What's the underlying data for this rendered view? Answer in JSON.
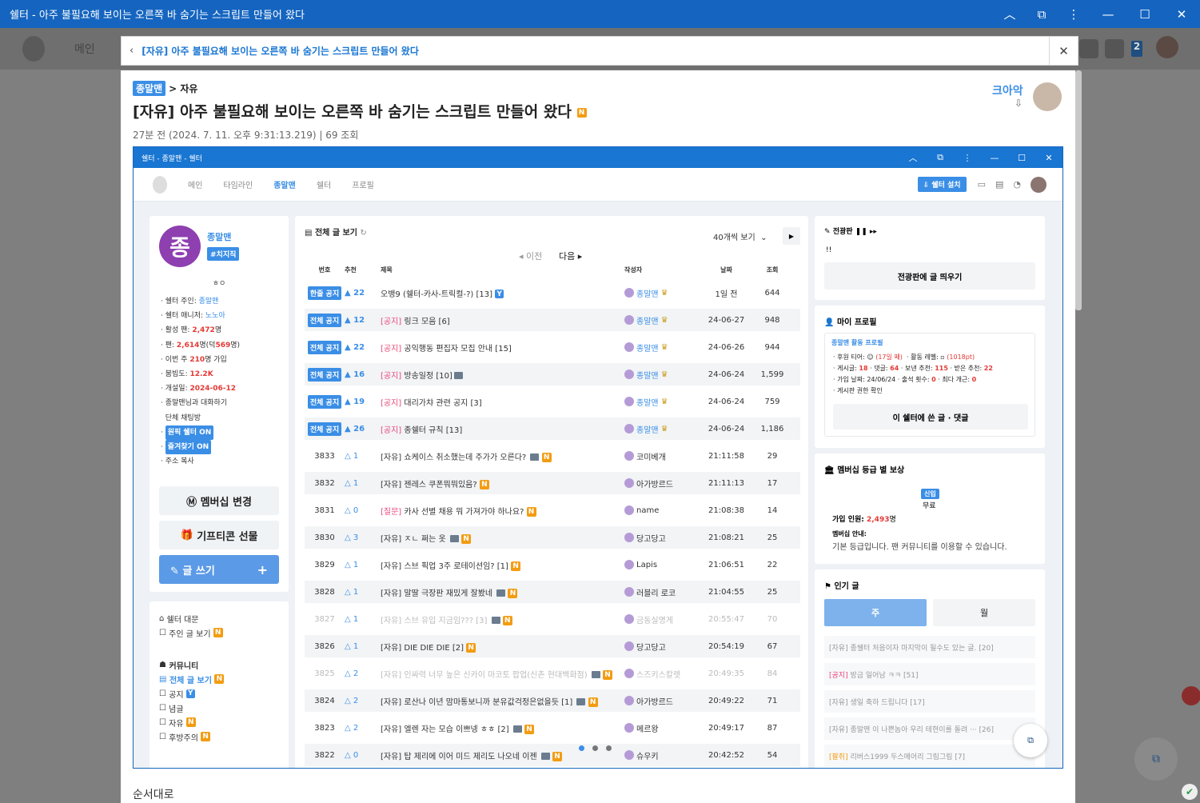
{
  "window": {
    "title": "쉘터 - 아주 불필요해 보이는 오른쪽 바 숨기는 스크립트 만들어 왔다"
  },
  "bg_nav": {
    "main": "메인",
    "notif_count": "2"
  },
  "navbar": {
    "title": "[자유] 아주 불필요해 보이는 오른쪽 바 숨기는 스크립트 만들어 왔다"
  },
  "post": {
    "board_badge": "종말맨",
    "board_path": "> 자유",
    "title": "[자유] 아주 불필요해 보이는 오른쪽 바 숨기는 스크립트 만들어 왔다",
    "new_badge": "N",
    "meta": "27분 전 (2024. 7. 11. 오후 9:31:13.219) | 69 조회",
    "author": "크아악",
    "body_text": "순서대로"
  },
  "shot": {
    "title": "쉘터 - 종말맨 - 쉘터",
    "nav": [
      "메인",
      "타임라인",
      "종말맨",
      "쉘터",
      "프로필"
    ],
    "install_btn": "쉘터 설치",
    "profile": {
      "avatar_char": "종",
      "name": "종말맨",
      "tag": "#치지직",
      "motto": "ㅎㅇ",
      "owner_label": "쉘터 주인:",
      "owner": "종말맨",
      "manager_label": "쉘터 매니저:",
      "manager": "노노아",
      "active_label": "활성 팬:",
      "active": "2,472",
      "unit_people": "명",
      "fans_label": "팬:",
      "fans": "2,614",
      "fans_mid": "명(덕",
      "fans_de": "569",
      "fans_end": "명)",
      "week_label": "이번 주",
      "week": "210",
      "week_end": "명 가입",
      "busy_label": "붐빔도:",
      "busy": "12.2K",
      "opened_label": "개설일:",
      "opened": "2024-06-12",
      "chat_link": "종말맨님과 대화하기",
      "group_chat": "단체 채팅방",
      "btn_pin": "원픽 쉘터 ON",
      "btn_fav": "즐겨찾기 ON",
      "copy_addr": "주소 복사",
      "membership_btn": "멤버십 변경",
      "gift_btn": "기프티콘 선물",
      "write_btn": "글 쓰기"
    },
    "side_links": {
      "door": "쉘터 대문",
      "owner_posts": "주인 글 보기",
      "community": "커뮤니티",
      "all_posts": "전체 글 보기",
      "notice": "공지",
      "best": "념글",
      "free": "자유",
      "rookie": "후방주의"
    },
    "list": {
      "heading": "전체 글 보기",
      "per_page": "40개씩 보기",
      "prev": "이전",
      "next": "다음",
      "headers": [
        "번호",
        "추천",
        "제목",
        "작성자",
        "날짜",
        "조회"
      ],
      "rows": [
        {
          "num": "한줄 공지",
          "rec": "▲ 22",
          "tag": "",
          "title": "오뱅9 (쉘터-카사-트릭컬-?) [13]",
          "author": "종말맨",
          "date": "1일 전",
          "views": "644"
        },
        {
          "num": "전체 공지",
          "rec": "▲ 12",
          "tag": "[공지]",
          "title": "링크 모음 [6]",
          "author": "종말맨",
          "date": "24-06-27",
          "views": "948"
        },
        {
          "num": "전체 공지",
          "rec": "▲ 22",
          "tag": "[공지]",
          "title": "공익행동 편집자 모집 안내 [15]",
          "author": "종말맨",
          "date": "24-06-26",
          "views": "944"
        },
        {
          "num": "전체 공지",
          "rec": "▲ 16",
          "tag": "[공지]",
          "title": "방송일정 [10]",
          "author": "종말맨",
          "date": "24-06-24",
          "views": "1,599"
        },
        {
          "num": "전체 공지",
          "rec": "▲ 19",
          "tag": "[공지]",
          "title": "대리가챠 관련 공지 [3]",
          "author": "종말맨",
          "date": "24-06-24",
          "views": "759"
        },
        {
          "num": "전체 공지",
          "rec": "▲ 26",
          "tag": "[공지]",
          "title": "종쉘터 규칙 [13]",
          "author": "종말맨",
          "date": "24-06-24",
          "views": "1,186"
        },
        {
          "num": "3833",
          "rec": "△ 1",
          "tag": "",
          "title": "[자유] 쇼케이스 취소했는데 주가가 오른다? ",
          "author": "코미베개",
          "date": "21:11:58",
          "views": "29"
        },
        {
          "num": "3832",
          "rec": "△ 1",
          "tag": "",
          "title": "[자유] 젠레스 쿠폰뭐뭐있음? ",
          "author": "아가방르드",
          "date": "21:11:13",
          "views": "17"
        },
        {
          "num": "3831",
          "rec": "△ 0",
          "tag": "[질문]",
          "title": "카사 선별 채용 뭐 가져가야 하나요? ",
          "author": "name",
          "date": "21:08:38",
          "views": "14"
        },
        {
          "num": "3830",
          "rec": "△ 3",
          "tag": "",
          "title": "[자유] ㅈㄴ 쩌는 옷 ",
          "author": "당고당고",
          "date": "21:08:21",
          "views": "25"
        },
        {
          "num": "3829",
          "rec": "△ 1",
          "tag": "",
          "title": "[자유] 스브 픽업 3주 로테이션임? [1] ",
          "author": "Lapis",
          "date": "21:06:51",
          "views": "22"
        },
        {
          "num": "3828",
          "rec": "△ 1",
          "tag": "",
          "title": "[자유] 말딸 극장판 재밌게 잘봤네 ",
          "author": "러블리 로코",
          "date": "21:04:55",
          "views": "25"
        },
        {
          "num": "3827",
          "rec": "△ 1",
          "tag": "",
          "title": "[자유] 스브 유입 지금임??? [3] ",
          "author": "금동실명게",
          "date": "20:55:47",
          "views": "70"
        },
        {
          "num": "3826",
          "rec": "△ 1",
          "tag": "",
          "title": "[자유] DIE DIE DIE [2] ",
          "author": "당고당고",
          "date": "20:54:19",
          "views": "67"
        },
        {
          "num": "3825",
          "rec": "△ 2",
          "tag": "",
          "title": "[자유] 인싸력 너무 높은 신카이 마코토 팝업(신촌 현대백화점) ",
          "author": "스즈키스칼렛",
          "date": "20:49:35",
          "views": "84"
        },
        {
          "num": "3824",
          "rec": "△ 2",
          "tag": "",
          "title": "[자유] 로산나 이년 맘마통보니까 분유값걱정은없을듯 [1] ",
          "author": "아가방르드",
          "date": "20:49:22",
          "views": "71"
        },
        {
          "num": "3823",
          "rec": "△ 2",
          "tag": "",
          "title": "[자유] 엘렌 자는 모습 이쁘넹 ㅎㅎ [2] ",
          "author": "메르왕",
          "date": "20:49:17",
          "views": "87"
        },
        {
          "num": "3822",
          "rec": "△ 0",
          "tag": "",
          "title": "[자유] 탑 제리에 이어 미드 제리도 나오네 이젠 ",
          "author": "슈우키",
          "date": "20:42:52",
          "views": "54"
        }
      ]
    },
    "board_panel": {
      "heading": "전광판",
      "text": "!!",
      "btn": "전광판에 글 띄우기"
    },
    "my_profile": {
      "heading": "마이 프로필",
      "sub": "종말맨 활동 프로필",
      "l1a": "후원 티어:",
      "l1b": "(17일 째)",
      "l1c": "활동 레벨:",
      "l1d": "(1018pt)",
      "l2a": "게시글:",
      "l2b": "18",
      "l2c": "댓글:",
      "l2d": "64",
      "l2e": "보낸 추천:",
      "l2f": "115",
      "l2g": "받은 추천:",
      "l2h": "22",
      "l3a": "가입 날짜: 24/06/24",
      "l3b": "출석 횟수:",
      "l3c": "0",
      "l3d": "최다 개근:",
      "l3e": "0",
      "l4": "게시판 권한 확인",
      "btn": "이 쉘터에 쓴 글 · 댓글"
    },
    "membership": {
      "heading": "멤버십 등급 별 보상",
      "tier": "신입",
      "free": "무료",
      "joined_label": "가입 인원:",
      "joined": "2,493",
      "unit": "명",
      "info_label": "멤버십 안내:",
      "info": "기본 등급입니다. 팬 커뮤니티를 이용할 수 있습니다."
    },
    "popular": {
      "heading": "인기 글",
      "tab_week": "주",
      "tab_month": "월",
      "items": [
        {
          "tag": "",
          "text": "[자유] 종쉘터 처음이자 마지막이 될수도 있는 글. [20]"
        },
        {
          "tag": "[공지]",
          "text": "방금 일어남 ㅋㅋ [51]"
        },
        {
          "tag": "",
          "text": "[자유] 생일 축하 드립니다 [17]"
        },
        {
          "tag": "",
          "text": "[자유] 종말맨 이 나쁜놈아 우리 테현이를 돌려 ··· [26]"
        },
        {
          "tag": "[팔취]",
          "text": "리버스1999 두스메어리 그림그림 [7]"
        }
      ]
    }
  }
}
